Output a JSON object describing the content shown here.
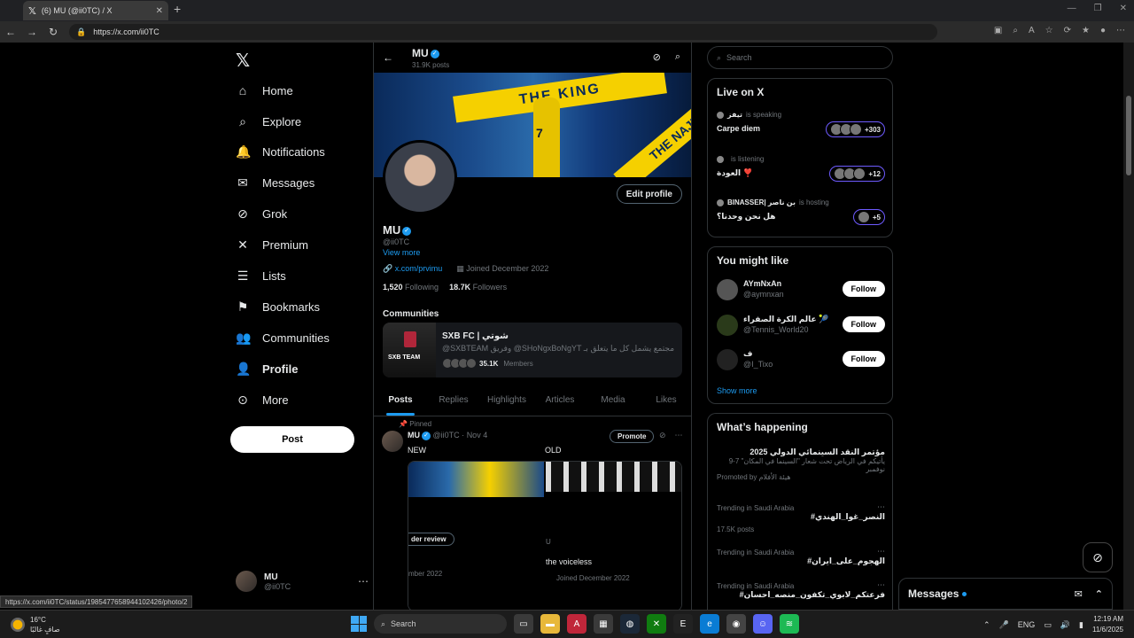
{
  "browser": {
    "tab_title": "(6) MU (@ii0TC) / X",
    "url": "https://x.com/ii0TC",
    "status_url": "https://x.com/ii0TC/status/1985477658944102426/photo/2"
  },
  "nav": {
    "items": [
      {
        "label": "Home",
        "icon": "home-icon"
      },
      {
        "label": "Explore",
        "icon": "search-icon"
      },
      {
        "label": "Notifications",
        "icon": "bell-icon"
      },
      {
        "label": "Messages",
        "icon": "mail-icon"
      },
      {
        "label": "Grok",
        "icon": "grok-icon"
      },
      {
        "label": "Premium",
        "icon": "x-icon"
      },
      {
        "label": "Lists",
        "icon": "list-icon"
      },
      {
        "label": "Bookmarks",
        "icon": "bookmark-icon"
      },
      {
        "label": "Communities",
        "icon": "people-icon"
      },
      {
        "label": "Profile",
        "icon": "person-icon"
      },
      {
        "label": "More",
        "icon": "more-circle-icon"
      }
    ],
    "post_label": "Post",
    "user_name": "MU",
    "user_handle": "@ii0TC"
  },
  "header": {
    "name": "MU",
    "posts_count": "31.9K posts"
  },
  "banner": {
    "text1": "THE KING",
    "text2": "THE NAJU",
    "jersey": "7"
  },
  "profile": {
    "edit_label": "Edit profile",
    "name": "MU",
    "handle": "@ii0TC",
    "view_more": "View more",
    "link": "x.com/prvimu",
    "joined": "Joined December 2022",
    "following_count": "1,520",
    "following_label": "Following",
    "followers_count": "18.7K",
    "followers_label": "Followers"
  },
  "communities": {
    "title": "Communities",
    "name": "SXB FC | شوتي",
    "description": "@SXBTEAM وفريق @SHoNgxBoNgYT مجتمع يشمل كل ما يتعلق بـ",
    "image_caption": "SXB TEAM",
    "members_count": "35.1K",
    "members_label": "Members"
  },
  "tabs": [
    "Posts",
    "Replies",
    "Highlights",
    "Articles",
    "Media",
    "Likes"
  ],
  "pinned_post": {
    "pinned_label": "Pinned",
    "author": "MU",
    "handle": "@ii0TC",
    "date": "Nov 4",
    "promote_label": "Promote",
    "text_left": "NEW",
    "text_right": "OLD",
    "img1_review": "der review",
    "img1_date": "mber 2022",
    "img2_u": "U",
    "img2_voice": "the voiceless",
    "img2_joined": "Joined December 2022"
  },
  "right": {
    "search_placeholder": "Search",
    "live_title": "Live on X",
    "live": [
      {
        "host": "تيفز",
        "status": "is speaking",
        "title": "Carpe diem",
        "count": "+303"
      },
      {
        "host": "",
        "status": "is listening",
        "title": "العودة ❣️",
        "count": "+12"
      },
      {
        "host": "BINASSER| بن ناصر",
        "status": "is hosting",
        "title": "هل نحن وحدنا؟",
        "count": "+5"
      }
    ],
    "wtf_title": "You might like",
    "wtf": [
      {
        "name": "AYmNxAn",
        "handle": "@aymnxan",
        "follow": "Follow"
      },
      {
        "name": "عالم الكرة الصفراء 🎾",
        "handle": "@Tennis_World20",
        "follow": "Follow"
      },
      {
        "name": "ف",
        "handle": "@I_Tixo",
        "follow": "Follow"
      }
    ],
    "show_more": "Show more",
    "trends_title": "What’s happening",
    "trends": [
      {
        "title": "مؤتمر النقد السينمائي الدولي 2025",
        "desc": "يأتيكم في الرياض تحت شعار \"السينما في المكان\" 7-9 نوفمبر",
        "promoted": "Promoted by هيئة الأفلام"
      },
      {
        "context": "Trending in Saudi Arabia",
        "title": "#النصر_غوا_الهندي",
        "posts": "17.5K posts"
      },
      {
        "context": "Trending in Saudi Arabia",
        "title": "#الهجوم_على_ايران"
      },
      {
        "context": "Trending in Saudi Arabia",
        "title": "#فرعتكم_لابوي_تكفون_منصه_احسان"
      }
    ]
  },
  "dock": {
    "messages_label": "Messages"
  },
  "taskbar": {
    "temp": "16°C",
    "weather": "صافٍ غالبًا",
    "search_label": "Search",
    "lang": "ENG",
    "time": "12:19 AM",
    "date": "11/6/2025"
  }
}
